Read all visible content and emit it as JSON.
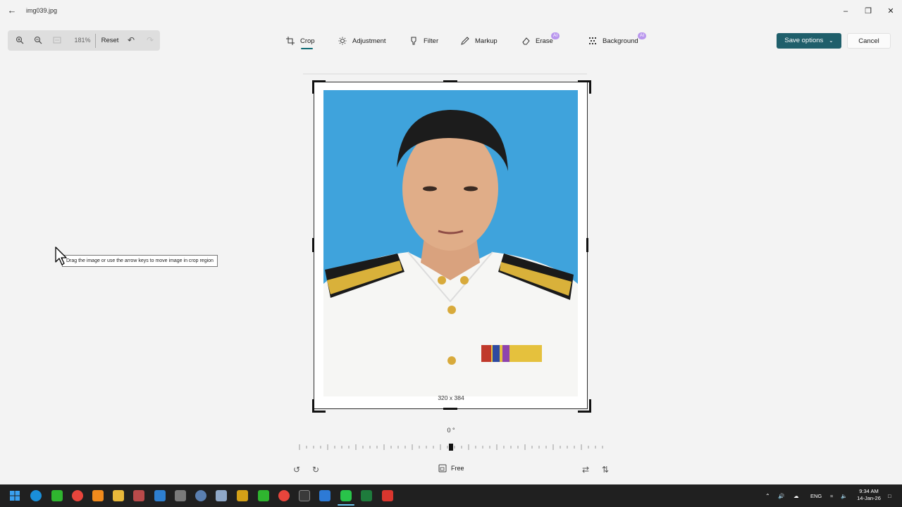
{
  "window": {
    "file_name": "img039.jpg"
  },
  "zoom_toolbar": {
    "zoom_level": "181%",
    "reset_label": "Reset"
  },
  "tools": {
    "crop": "Crop",
    "adjustment": "Adjustment",
    "filter": "Filter",
    "markup": "Markup",
    "erase": "Erase",
    "background": "Background",
    "ai_badge": "AI"
  },
  "actions": {
    "save_label": "Save options",
    "cancel_label": "Cancel"
  },
  "canvas": {
    "tooltip": "Drag the image or use the arrow keys to move image in crop region",
    "dimensions": "320 x 384",
    "rotation": "0 °"
  },
  "bottom_bar": {
    "aspect_label": "Free"
  },
  "taskbar": {
    "language": "ENG",
    "time": "9:34 AM",
    "date": "14-Jan-26"
  },
  "colors": {
    "accent": "#1f5f6b",
    "ai_badge": "#b996ee",
    "photo_background": "#3fa3dc"
  }
}
